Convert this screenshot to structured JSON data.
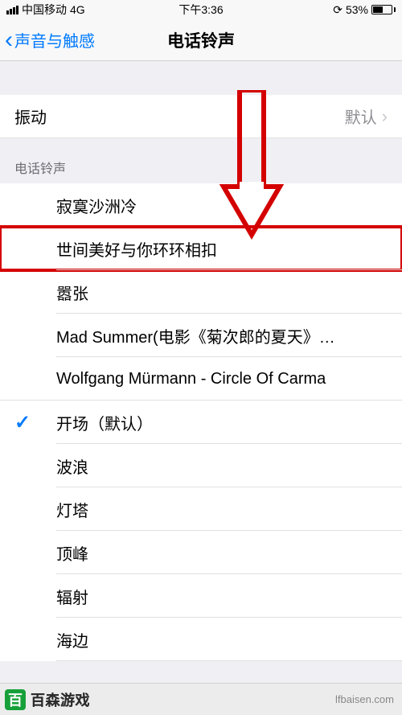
{
  "status": {
    "carrier": "中国移动",
    "network": "4G",
    "time": "下午3:36",
    "battery_pct": "53%"
  },
  "nav": {
    "back_label": "声音与触感",
    "title": "电话铃声"
  },
  "vibration": {
    "label": "振动",
    "value": "默认"
  },
  "ringtones": {
    "header": "电话铃声",
    "custom": [
      "寂寞沙洲冷",
      "世间美好与你环环相扣",
      "嚣张",
      "Mad Summer(电影《菊次郎的夏天》…",
      "Wolfgang Mürmann - Circle Of Carma"
    ],
    "builtin": [
      "开场（默认）",
      "波浪",
      "灯塔",
      "顶峰",
      "辐射",
      "海边"
    ],
    "selected_index": 0
  },
  "annotation": {
    "highlight_custom_index": 1
  },
  "watermark": {
    "logo_letter": "百",
    "brand": "百森游戏",
    "url": "lfbaisen.com"
  }
}
